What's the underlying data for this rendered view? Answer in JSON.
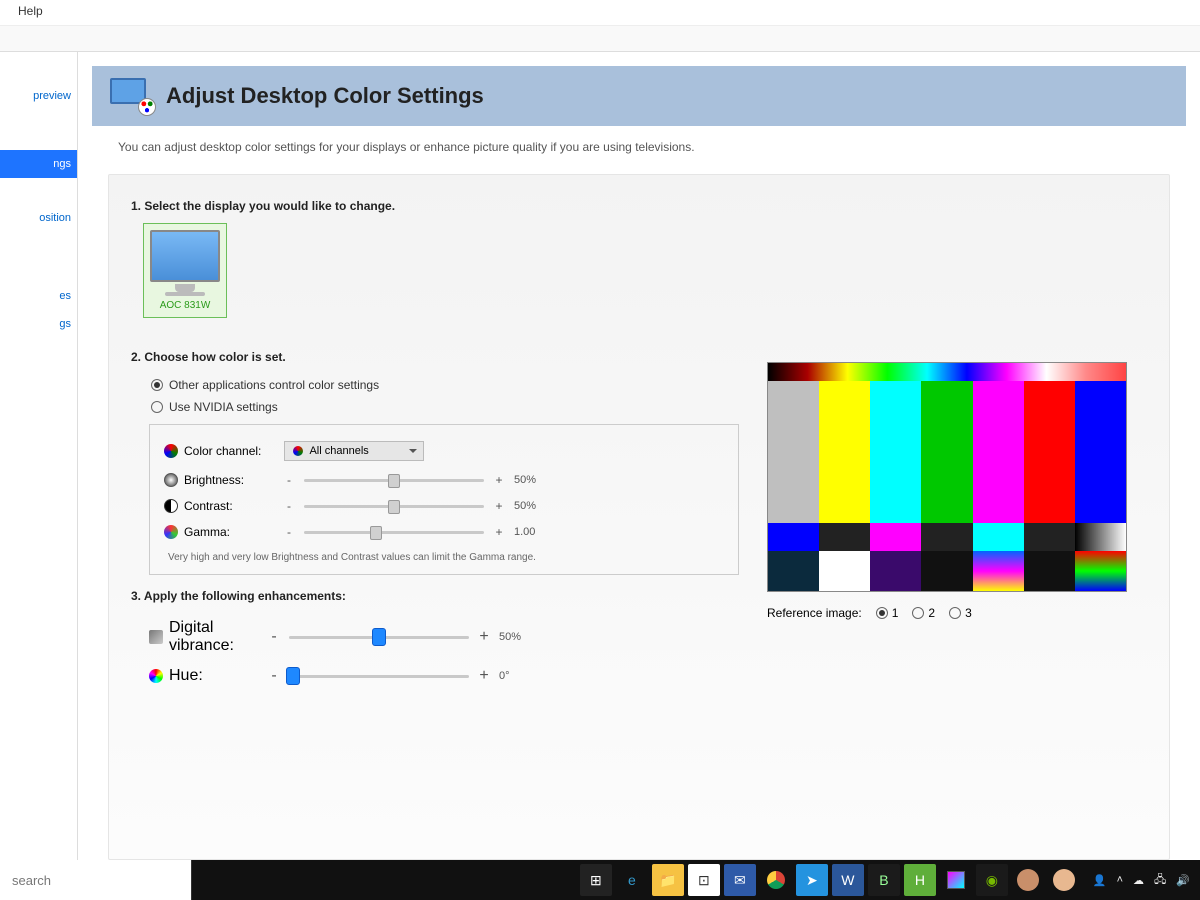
{
  "menu": {
    "help": "Help"
  },
  "sidebar": {
    "items": [
      {
        "label": "preview"
      },
      {
        "label": "ngs"
      },
      {
        "label": "osition"
      },
      {
        "label": "es"
      },
      {
        "label": "gs"
      }
    ]
  },
  "header": {
    "title": "Adjust Desktop Color Settings",
    "description": "You can adjust desktop color settings for your displays or enhance picture quality if you are using televisions."
  },
  "section1": {
    "title": "1. Select the display you would like to change.",
    "display_name": "AOC 831W"
  },
  "section2": {
    "title": "2. Choose how color is set.",
    "radio_other": "Other applications control color settings",
    "radio_nvidia": "Use NVIDIA settings",
    "color_channel_label": "Color channel:",
    "color_channel_value": "All channels",
    "brightness_label": "Brightness:",
    "brightness_value": "50%",
    "brightness_pct": 50,
    "contrast_label": "Contrast:",
    "contrast_value": "50%",
    "contrast_pct": 50,
    "gamma_label": "Gamma:",
    "gamma_value": "1.00",
    "gamma_pct": 40,
    "note": "Very high and very low Brightness and Contrast values can limit the Gamma range."
  },
  "section3": {
    "title": "3. Apply the following enhancements:",
    "vibrance_label": "Digital vibrance:",
    "vibrance_value": "50%",
    "vibrance_pct": 50,
    "hue_label": "Hue:",
    "hue_value": "0°",
    "hue_pct": 2
  },
  "reference": {
    "label": "Reference image:",
    "opt1": "1",
    "opt2": "2",
    "opt3": "3"
  },
  "taskbar": {
    "search_placeholder": "search"
  }
}
